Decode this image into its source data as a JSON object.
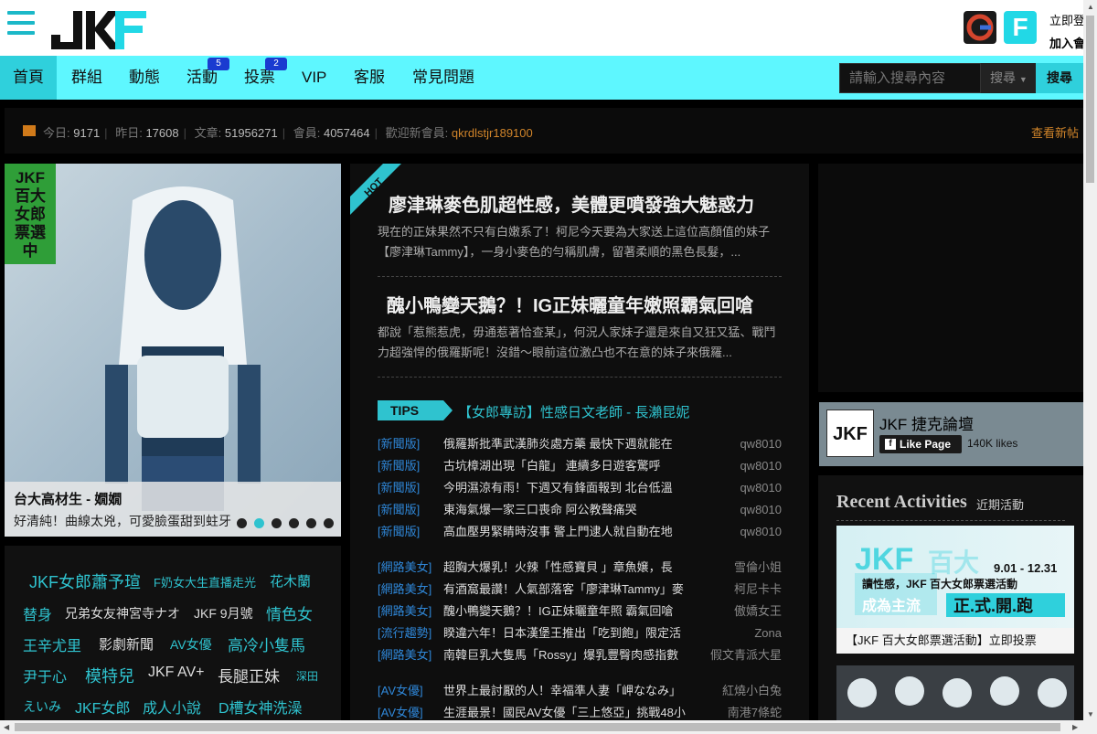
{
  "header": {
    "login": "立即登",
    "join": "加入會"
  },
  "nav": {
    "items": [
      {
        "label": "首頁"
      },
      {
        "label": "群組"
      },
      {
        "label": "動態"
      },
      {
        "label": "活動",
        "badge": "5"
      },
      {
        "label": "投票",
        "badge": "2"
      },
      {
        "label": "VIP"
      },
      {
        "label": "客服"
      },
      {
        "label": "常見問題"
      }
    ],
    "search_placeholder": "請輸入搜尋內容",
    "search_select": "搜尋",
    "search_button": "搜尋"
  },
  "stats": {
    "today_label": "今日:",
    "today": "9171",
    "yesterday_label": "昨日:",
    "yesterday": "17608",
    "posts_label": "文章:",
    "posts": "51956271",
    "members_label": "會員:",
    "members": "4057464",
    "welcome_label": "歡迎新會員:",
    "new_member": "qkrdlstjr189100",
    "view_new": "查看新帖"
  },
  "hero": {
    "ribbon": "JKF 百大 女郎 票選中",
    "title": "台大高材生 - 嫺嫺",
    "subtitle": "好清純！曲線太兇，可愛臉蛋甜到蛀牙"
  },
  "tags": [
    {
      "text": "JKF女郎蕭予瑄",
      "color": "#2fc3cf",
      "size": 18
    },
    {
      "text": "F奶女大生直播走光",
      "color": "#2fc3cf",
      "size": 13
    },
    {
      "text": "花木蘭",
      "color": "#2fc3cf",
      "size": 15
    },
    {
      "text": "替身",
      "color": "#2fc3cf",
      "size": 16
    },
    {
      "text": "兄弟女友神宮寺ナオ",
      "color": "#ddd",
      "size": 14
    },
    {
      "text": "JKF 9月號",
      "color": "#ddd",
      "size": 14
    },
    {
      "text": "情色女",
      "color": "#2fc3cf",
      "size": 17
    },
    {
      "text": "王辛尤里",
      "color": "#2fc3cf",
      "size": 16
    },
    {
      "text": "影劇新聞",
      "color": "#ddd",
      "size": 15
    },
    {
      "text": "AV女優",
      "color": "#2fc3cf",
      "size": 14
    },
    {
      "text": "高冷小隻馬",
      "color": "#2fc3cf",
      "size": 17
    },
    {
      "text": "尹于心",
      "color": "#2fc3cf",
      "size": 16
    },
    {
      "text": "模特兒",
      "color": "#2fc3cf",
      "size": 18
    },
    {
      "text": "JKF AV+",
      "color": "#ddd",
      "size": 16
    },
    {
      "text": "長腿正妹",
      "color": "#ddd",
      "size": 17
    },
    {
      "text": "深田",
      "color": "#2fc3cf",
      "size": 12
    },
    {
      "text": "えいみ",
      "color": "#2fc3cf",
      "size": 14
    },
    {
      "text": "JKF女郎",
      "color": "#2fc3cf",
      "size": 16
    },
    {
      "text": "成人小說",
      "color": "#2fc3cf",
      "size": 16
    },
    {
      "text": "D槽女神洗澡",
      "color": "#2fc3cf",
      "size": 16
    }
  ],
  "articles": [
    {
      "title": "廖津琳麥色肌超性感，美體更噴發強大魅惑力",
      "desc": "現在的正妹果然不只有白嫩系了！柯尼今天要為大家送上這位高顏值的妹子【廖津琳Tammy】，一身小麥色的勻稱肌膚，留著柔順的黑色長髮，..."
    },
    {
      "title": "醜小鴨變天鵝？！IG正妹曬童年嫩照霸氣回嗆",
      "desc": "都說「惹熊惹虎，毋通惹著恰查某」，何況人家妹子還是來自又狂又猛、戰鬥力超強悍的俄羅斯呢！沒錯～眼前這位激凸也不在意的妹子來俄羅..."
    }
  ],
  "tips": {
    "badge": "TIPS",
    "title": "【女郎專訪】性感日文老師 - 長瀨昆妮"
  },
  "news": [
    {
      "cat": "[新聞版]",
      "title": "俄羅斯批準武漢肺炎處方藥 最快下週就能在",
      "author": "qw8010"
    },
    {
      "cat": "[新聞版]",
      "title": "古坑樟湖出現「白龍」 連續多日遊客驚呼",
      "author": "qw8010"
    },
    {
      "cat": "[新聞版]",
      "title": "今明濕涼有雨！下週又有鋒面報到 北台低溫",
      "author": "qw8010"
    },
    {
      "cat": "[新聞版]",
      "title": "東海氣爆一家三口喪命 阿公教聲痛哭",
      "author": "qw8010"
    },
    {
      "cat": "[新聞版]",
      "title": "高血壓男緊睛時沒事 警上門逮人就自動在地",
      "author": "qw8010"
    },
    {
      "cat": "[網路美女]",
      "title": "超胸大爆乳！火辣「性感寶貝 」章魚嬢，長",
      "author": "雪倫小姐"
    },
    {
      "cat": "[網路美女]",
      "title": "有酒窩最讚！人氣部落客「廖津琳Tammy」麥",
      "author": "柯尼卡卡"
    },
    {
      "cat": "[網路美女]",
      "title": "醜小鴨變天鵝？！IG正妹曬童年照 霸氣回嗆",
      "author": "傲嬌女王"
    },
    {
      "cat": "[流行趨勢]",
      "title": "睽違六年！日本漢堡王推出「吃到飽」限定活",
      "author": "Zona"
    },
    {
      "cat": "[網路美女]",
      "title": "南韓巨乳大隻馬「Rossy」爆乳豐臀肉感指數",
      "author": "假文青派大星"
    },
    {
      "cat": "[AV女優]",
      "title": "世界上最討厭的人！幸福準人妻「岬ななみ」",
      "author": "紅燒小白兔"
    },
    {
      "cat": "[AV女優]",
      "title": "生涯最景！國民AV女優「三上悠亞」挑戰48小",
      "author": "南港7條蛇"
    }
  ],
  "facebook": {
    "page_name": "JKF 捷克論壇",
    "like_button": "Like Page",
    "likes": "140K likes",
    "logo_text": "JKF"
  },
  "activities": {
    "title": "Recent Activities",
    "subtitle": "近期活動",
    "banner_caption": "【JKF 百大女郎票選活動】立即投票",
    "banner_dates": "9.01 - 12.31",
    "banner_line1": "讀性感，JKF 百大女郎票選活動",
    "banner_line2": "成為主流",
    "banner_line3": "正.式.開.跑"
  }
}
